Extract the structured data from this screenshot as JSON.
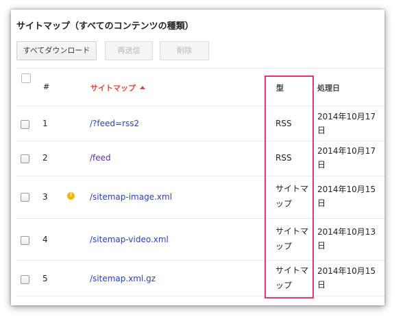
{
  "page": {
    "title": "サイトマップ（すべてのコンテンツの種類）"
  },
  "toolbar": {
    "download_all": "すべてダウンロード",
    "resend": "再送信",
    "delete": "削除"
  },
  "table": {
    "headers": {
      "index": "#",
      "sitemap": "サイトマップ",
      "type": "型",
      "processed": "処理日"
    },
    "sort": {
      "column": "sitemap",
      "direction": "ascending"
    },
    "rows": [
      {
        "index": "1",
        "path": "/?feed=rss2",
        "type": "RSS",
        "date": "2014年10月17日",
        "warning": false,
        "link_color": "#2a3fba"
      },
      {
        "index": "2",
        "path": "/feed",
        "type": "RSS",
        "date": "2014年10月17日",
        "warning": false,
        "link_color": "#5b2bb0"
      },
      {
        "index": "3",
        "path": "/sitemap-image.xml",
        "type": "サイトマップ",
        "date": "2014年10月15日",
        "warning": true,
        "warning_icon": "exclamation-icon",
        "link_color": "#2a3fba"
      },
      {
        "index": "4",
        "path": "/sitemap-video.xml",
        "type": "サイトマップ",
        "date": "2014年10月13日",
        "warning": false,
        "link_color": "#2a3fba"
      },
      {
        "index": "5",
        "path": "/sitemap.xml.gz",
        "type": "サイトマップ",
        "date": "2014年10月15日",
        "warning": false,
        "link_color": "#2a3fba"
      }
    ]
  },
  "colors": {
    "sort_active": "#dd4b39",
    "link": "#2a3fba",
    "highlight_border": "#e0337a",
    "warning": "#f4b400"
  }
}
